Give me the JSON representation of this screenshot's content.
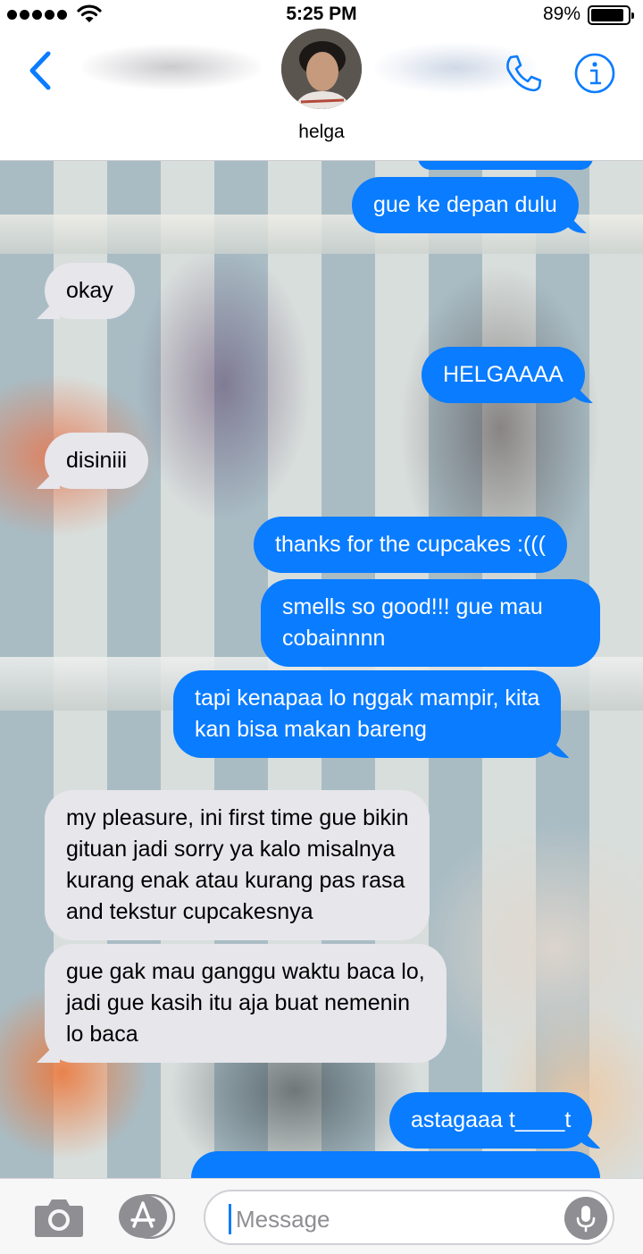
{
  "status_bar": {
    "time": "5:25 PM",
    "battery_percent": "89%",
    "battery_level": 0.89,
    "signal_bars": 5
  },
  "header": {
    "contact_name": "helga",
    "icons": [
      "back-chevron-icon",
      "phone-icon",
      "info-icon"
    ],
    "accent_color": "#0a7cff"
  },
  "messages": [
    {
      "sender": "me",
      "text": "gue ke depan dulu"
    },
    {
      "sender": "them",
      "text": "okay"
    },
    {
      "sender": "me",
      "text": "HELGAAAA"
    },
    {
      "sender": "them",
      "text": "disiniii"
    },
    {
      "sender": "me",
      "text": "thanks for the cupcakes :((("
    },
    {
      "sender": "me",
      "text": "smells so good!!! gue mau\ncobainnnn"
    },
    {
      "sender": "me",
      "text": "tapi kenapaa lo nggak mampir, kita\nkan bisa makan bareng"
    },
    {
      "sender": "them",
      "text": "my pleasure, ini first time gue bikin\ngituan jadi sorry ya kalo misalnya\nkurang enak atau kurang pas rasa\nand tekstur cupcakesnya"
    },
    {
      "sender": "them",
      "text": "gue gak mau ganggu waktu baca lo,\njadi gue kasih itu aja buat nemenin\nlo baca"
    },
    {
      "sender": "me",
      "text": "astagaaa t____t"
    }
  ],
  "input_bar": {
    "placeholder": "Message",
    "icons": [
      "camera-icon",
      "app-store-icon",
      "microphone-icon"
    ]
  },
  "colors": {
    "outgoing_bubble": "#0a7cff",
    "incoming_bubble": "#e6e6eb"
  }
}
